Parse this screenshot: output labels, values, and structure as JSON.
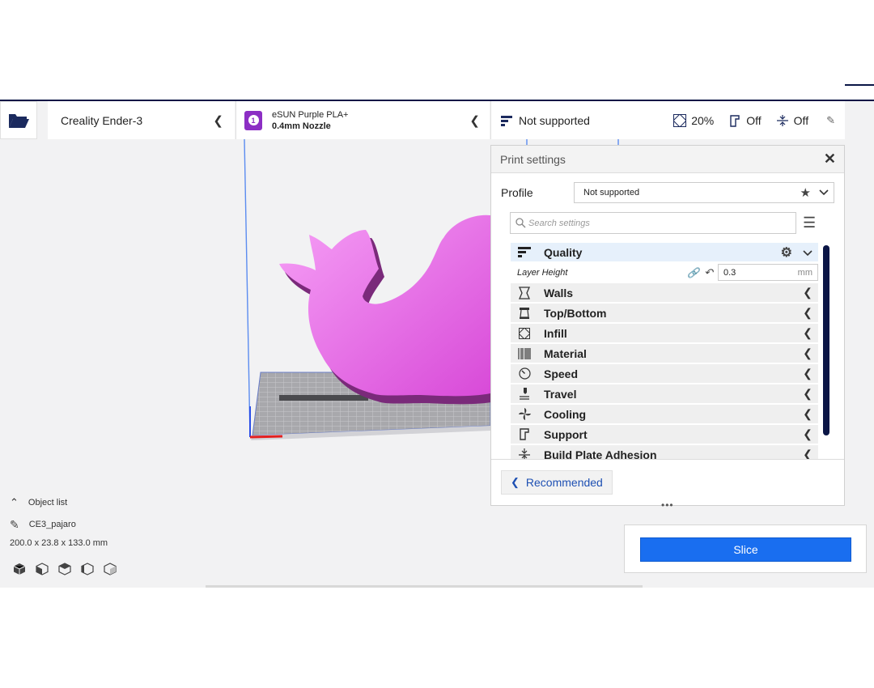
{
  "header": {
    "open_icon": "folder-open-icon",
    "printer_name": "Creality Ender-3",
    "material_extruder_number": "1",
    "material_name": "eSUN Purple PLA+",
    "material_nozzle": "0.4mm Nozzle",
    "profile_summary": "Not supported",
    "infill_value": "20%",
    "support_value": "Off",
    "adhesion_value": "Off"
  },
  "print_settings": {
    "title": "Print settings",
    "profile_label": "Profile",
    "profile_value": "Not supported",
    "search_placeholder": "Search settings",
    "categories": [
      {
        "label": "Quality",
        "icon": "quality-icon",
        "expanded": true
      },
      {
        "label": "Walls",
        "icon": "walls-icon"
      },
      {
        "label": "Top/Bottom",
        "icon": "top-bottom-icon"
      },
      {
        "label": "Infill",
        "icon": "infill-icon"
      },
      {
        "label": "Material",
        "icon": "material-icon"
      },
      {
        "label": "Speed",
        "icon": "speed-icon"
      },
      {
        "label": "Travel",
        "icon": "travel-icon"
      },
      {
        "label": "Cooling",
        "icon": "cooling-icon"
      },
      {
        "label": "Support",
        "icon": "support-icon"
      },
      {
        "label": "Build Plate Adhesion",
        "icon": "build-plate-adhesion-icon"
      }
    ],
    "layer_height": {
      "label": "Layer Height",
      "value": "0.3",
      "unit": "mm"
    },
    "recommended_label": "Recommended"
  },
  "object_list": {
    "header": "Object list",
    "object_name": "CE3_pajaro",
    "dimensions": "200.0 x 23.8 x 133.0 mm"
  },
  "slice": {
    "label": "Slice"
  },
  "colors": {
    "accent": "#196ef0",
    "model": "#e05ae0",
    "material_badge": "#8c2ec4",
    "topbar": "#0b1646"
  }
}
